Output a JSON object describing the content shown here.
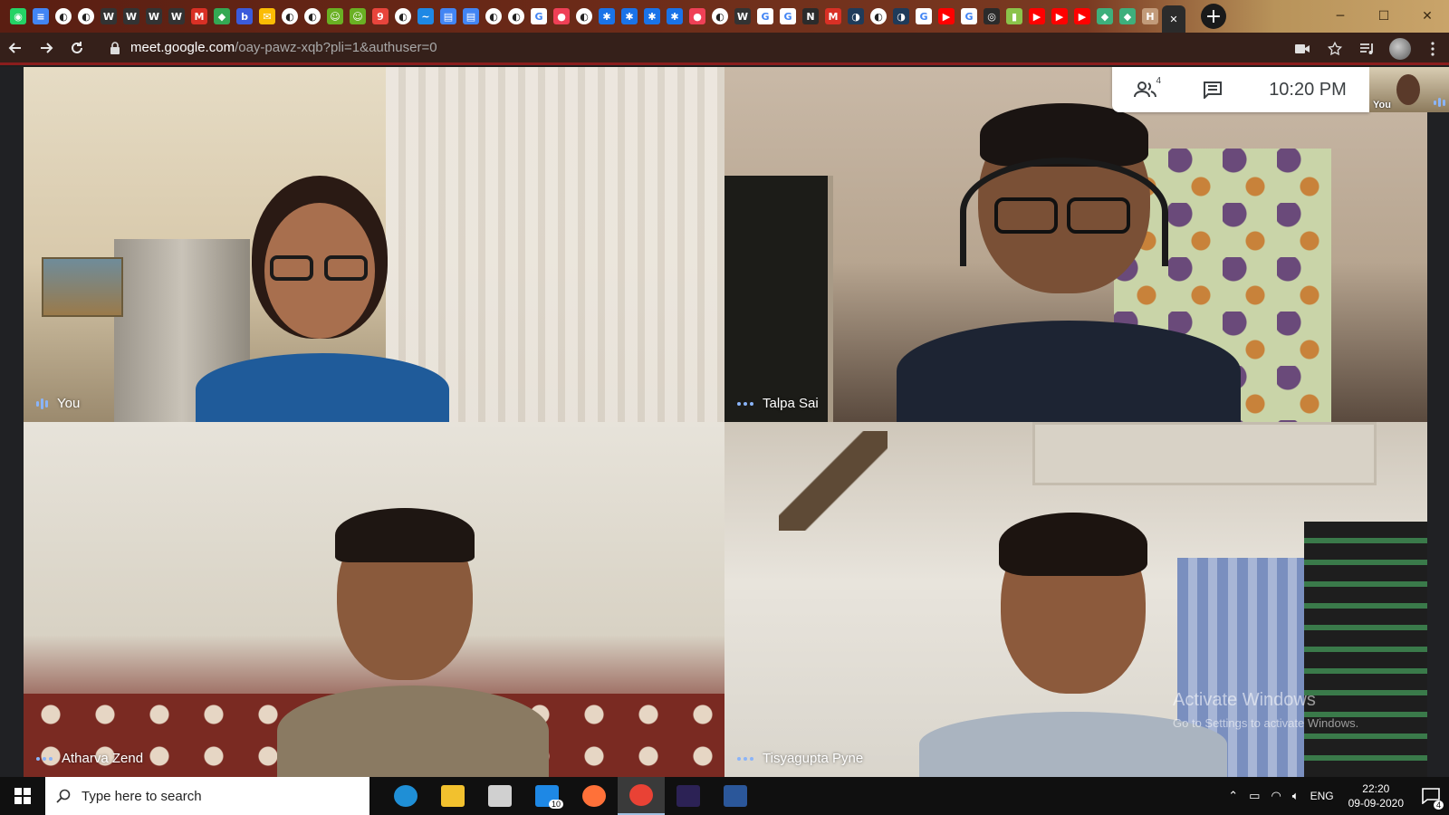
{
  "browser": {
    "tabs": [
      {
        "icon": "whatsapp-icon",
        "glyph": "◉",
        "color": "#25d366"
      },
      {
        "icon": "docs-icon",
        "glyph": "≡",
        "color": "#4285f4"
      },
      {
        "icon": "blank-page-icon",
        "glyph": "◐",
        "color": "#555555"
      },
      {
        "icon": "blank-page-icon",
        "glyph": "◐",
        "color": "#555555"
      },
      {
        "icon": "wikipedia-icon",
        "glyph": "W",
        "color": "#333333"
      },
      {
        "icon": "wikipedia-icon",
        "glyph": "W",
        "color": "#333333"
      },
      {
        "icon": "wikipedia-icon",
        "glyph": "W",
        "color": "#333333"
      },
      {
        "icon": "wikipedia-icon",
        "glyph": "W",
        "color": "#333333"
      },
      {
        "icon": "gmail-icon",
        "glyph": "M",
        "color": "#d93025"
      },
      {
        "icon": "chat-icon",
        "glyph": "◆",
        "color": "#34a853"
      },
      {
        "icon": "b-icon",
        "glyph": "b",
        "color": "#3b5bdb"
      },
      {
        "icon": "mail-icon",
        "glyph": "✉",
        "color": "#fbbc04"
      },
      {
        "icon": "blank-page-icon",
        "glyph": "◐",
        "color": "#555555"
      },
      {
        "icon": "blank-page-icon",
        "glyph": "◐",
        "color": "#555555"
      },
      {
        "icon": "smiley-icon",
        "glyph": "☺",
        "color": "#6ab023"
      },
      {
        "icon": "smiley-icon",
        "glyph": "☺",
        "color": "#6ab023"
      },
      {
        "icon": "calendar-icon",
        "glyph": "9",
        "color": "#e8453c"
      },
      {
        "icon": "blank-page-icon",
        "glyph": "◐",
        "color": "#555555"
      },
      {
        "icon": "stream-icon",
        "glyph": "~",
        "color": "#1e88e5"
      },
      {
        "icon": "doc-icon",
        "glyph": "▤",
        "color": "#4285f4"
      },
      {
        "icon": "doc-icon",
        "glyph": "▤",
        "color": "#4285f4"
      },
      {
        "icon": "blank-page-icon",
        "glyph": "◐",
        "color": "#555555"
      },
      {
        "icon": "blank-page-icon",
        "glyph": "◐",
        "color": "#555555"
      },
      {
        "icon": "google-icon",
        "glyph": "G",
        "color": "#ffffff"
      },
      {
        "icon": "pocket-icon",
        "glyph": "●",
        "color": "#ef4056"
      },
      {
        "icon": "blank-page-icon",
        "glyph": "◐",
        "color": "#555555"
      },
      {
        "icon": "network-icon",
        "glyph": "✱",
        "color": "#1a73e8"
      },
      {
        "icon": "network-icon",
        "glyph": "✱",
        "color": "#1a73e8"
      },
      {
        "icon": "network-icon",
        "glyph": "✱",
        "color": "#1a73e8"
      },
      {
        "icon": "network-icon",
        "glyph": "✱",
        "color": "#1a73e8"
      },
      {
        "icon": "pocket-icon",
        "glyph": "●",
        "color": "#ef4056"
      },
      {
        "icon": "blank-page-icon",
        "glyph": "◐",
        "color": "#555555"
      },
      {
        "icon": "wikipedia-icon",
        "glyph": "W",
        "color": "#333333"
      },
      {
        "icon": "google-icon",
        "glyph": "G",
        "color": "#ffffff"
      },
      {
        "icon": "google-icon",
        "glyph": "G",
        "color": "#ffffff"
      },
      {
        "icon": "notion-icon",
        "glyph": "N",
        "color": "#2b2b2b"
      },
      {
        "icon": "gmail-icon",
        "glyph": "M",
        "color": "#d93025"
      },
      {
        "icon": "globe-icon",
        "glyph": "◑",
        "color": "#1f3b5a"
      },
      {
        "icon": "blank-page-icon",
        "glyph": "◐",
        "color": "#555555"
      },
      {
        "icon": "globe-icon",
        "glyph": "◑",
        "color": "#1f3b5a"
      },
      {
        "icon": "google-icon",
        "glyph": "G",
        "color": "#ffffff"
      },
      {
        "icon": "youtube-icon",
        "glyph": "▶",
        "color": "#ff0000"
      },
      {
        "icon": "google-icon",
        "glyph": "G",
        "color": "#ffffff"
      },
      {
        "icon": "circle-icon",
        "glyph": "◎",
        "color": "#2b2b2b"
      },
      {
        "icon": "book-icon",
        "glyph": "▮",
        "color": "#8bc34a"
      },
      {
        "icon": "youtube-icon",
        "glyph": "▶",
        "color": "#ff0000"
      },
      {
        "icon": "youtube-icon",
        "glyph": "▶",
        "color": "#ff0000"
      },
      {
        "icon": "youtube-icon",
        "glyph": "▶",
        "color": "#ff0000"
      },
      {
        "icon": "vue-icon",
        "glyph": "◆",
        "color": "#3eaf7c"
      },
      {
        "icon": "vue-icon",
        "glyph": "◆",
        "color": "#3eaf7c"
      },
      {
        "icon": "hackerrank-icon",
        "glyph": "H",
        "color": "#c29b7a"
      },
      {
        "icon": "meet-active-tab-close-icon",
        "glyph": "✕",
        "color": "#2b2b2b",
        "active": true
      }
    ],
    "new_tab_glyph": "+",
    "window_controls": [
      "─",
      "☐",
      "✕"
    ],
    "url_host": "meet.google.com",
    "url_path": "/oay-pawz-xqb?pli=1&authuser=0"
  },
  "meet": {
    "participants_count": "4",
    "time": "10:20 PM",
    "self_label": "You",
    "tiles": [
      {
        "name": "You",
        "indicator": "speaking"
      },
      {
        "name": "Talpa Sai",
        "indicator": "dots"
      },
      {
        "name": "Atharva Zend",
        "indicator": "dots"
      },
      {
        "name": "Tisyagupta Pyne",
        "indicator": "dots"
      }
    ],
    "watermark_title": "Activate Windows",
    "watermark_sub": "Go to Settings to activate Windows."
  },
  "taskbar": {
    "search_placeholder": "Type here to search",
    "apps": [
      {
        "icon": "edge-icon",
        "color": "#1f8fd6"
      },
      {
        "icon": "file-explorer-icon",
        "color": "#f2c12e"
      },
      {
        "icon": "store-icon",
        "color": "#d0d0d0"
      },
      {
        "icon": "mail-icon",
        "color": "#1e88e5",
        "badge": "10"
      },
      {
        "icon": "firefox-icon",
        "color": "#ff7139"
      },
      {
        "icon": "chrome-icon",
        "color": "#e94235",
        "active": true
      },
      {
        "icon": "eclipse-icon",
        "color": "#2c2255"
      },
      {
        "icon": "word-icon",
        "color": "#2b579a"
      }
    ],
    "tray_lang": "ENG",
    "tray_time": "22:20",
    "tray_date": "09-09-2020",
    "notification_count": "4"
  },
  "colors": {
    "meet_blue": "#8ab4f8",
    "address_bar_accent": "#8a1d1d"
  }
}
